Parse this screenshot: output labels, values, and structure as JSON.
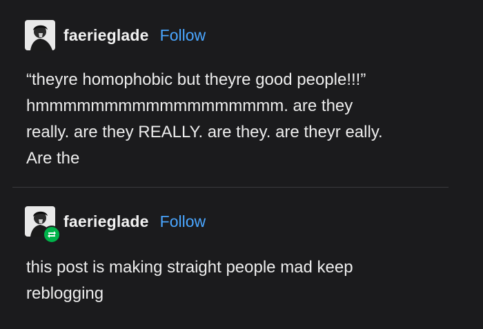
{
  "posts": [
    {
      "username": "faerieglade",
      "follow_label": "Follow",
      "avatar_icon": "user-avatar-icon",
      "text": "“theyre homophobic but theyre good people!!!”\nhmmmmmmmmmmmmmmmmmm. are they\nreally. are they REALLY. are they. are theyr eally.\nAre the"
    },
    {
      "username": "faerieglade",
      "follow_label": "Follow",
      "avatar_icon": "user-avatar-icon",
      "reblog_icon": "reblog-icon",
      "text": "this post is making straight people mad keep\nreblogging"
    }
  ],
  "colors": {
    "background": "#1b1b1d",
    "text": "#ededed",
    "follow": "#4aa6ff",
    "reblog_badge": "#00b34a"
  }
}
